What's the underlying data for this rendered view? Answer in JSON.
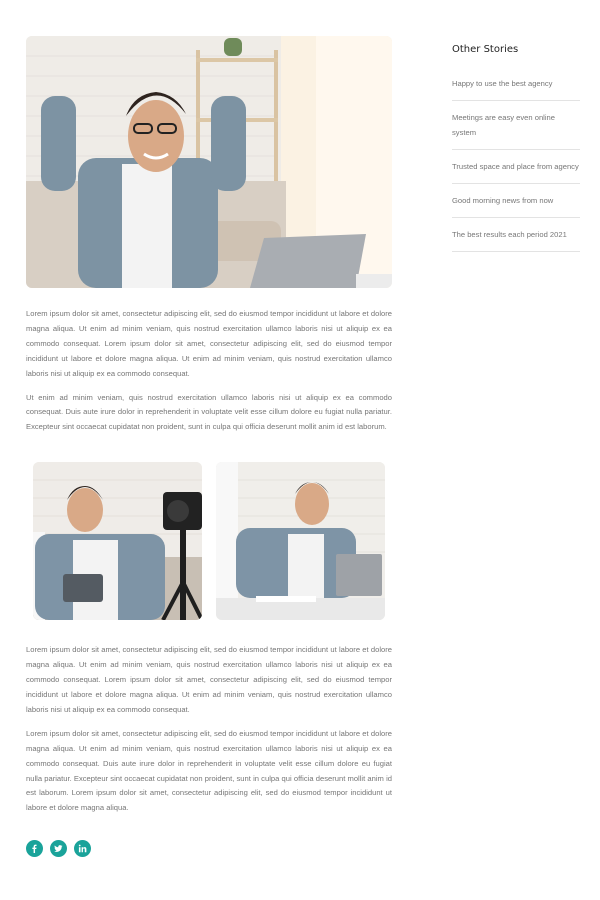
{
  "sidebar": {
    "title": "Other Stories",
    "stories": [
      {
        "label": "Happy to use the best agency"
      },
      {
        "label": "Meetings are easy even online system"
      },
      {
        "label": "Trusted space and place from agency"
      },
      {
        "label": "Good morning news from now"
      },
      {
        "label": "The best results each period 2021"
      }
    ]
  },
  "article": {
    "paragraphs": [
      "Lorem ipsum dolor sit amet, consectetur adipiscing elit, sed do eiusmod tempor incididunt ut labore et dolore magna aliqua. Ut enim ad minim veniam, quis nostrud exercitation ullamco laboris nisi ut aliquip ex ea commodo consequat. Lorem ipsum dolor sit amet, consectetur adipiscing elit, sed do eiusmod tempor incididunt ut labore et dolore magna aliqua. Ut enim ad minim veniam, quis nostrud exercitation ullamco laboris nisi ut aliquip ex ea commodo consequat.",
      "Ut enim ad minim veniam, quis nostrud exercitation ullamco laboris nisi ut aliquip ex ea commodo consequat. Duis aute irure dolor in reprehenderit in voluptate velit esse cillum dolore eu fugiat nulla pariatur. Excepteur sint occaecat cupidatat non proident, sunt in culpa qui officia deserunt mollit anim id est laborum.",
      "Lorem ipsum dolor sit amet, consectetur adipiscing elit, sed do eiusmod tempor incididunt ut labore et dolore magna aliqua. Ut enim ad minim veniam, quis nostrud exercitation ullamco laboris nisi ut aliquip ex ea commodo consequat. Lorem ipsum dolor sit amet, consectetur adipiscing elit, sed do eiusmod tempor incididunt ut labore et dolore magna aliqua. Ut enim ad minim veniam, quis nostrud exercitation ullamco laboris nisi ut aliquip ex ea commodo consequat.",
      "Lorem ipsum dolor sit amet, consectetur adipiscing elit, sed do eiusmod tempor incididunt ut labore et dolore magna aliqua. Ut enim ad minim veniam, quis nostrud exercitation ullamco laboris nisi ut aliquip ex ea commodo consequat. Duis aute irure dolor in reprehenderit in voluptate velit esse cillum dolore eu fugiat nulla pariatur. Excepteur sint occaecat cupidatat non proident, sunt in culpa qui officia deserunt mollit anim id est laborum. Lorem ipsum dolor sit amet, consectetur adipiscing elit, sed do eiusmod tempor incididunt ut labore et dolore magna aliqua."
    ]
  },
  "social": {
    "accent_color": "#1aa39a",
    "icons": [
      "facebook-icon",
      "twitter-icon",
      "linkedin-icon"
    ]
  }
}
